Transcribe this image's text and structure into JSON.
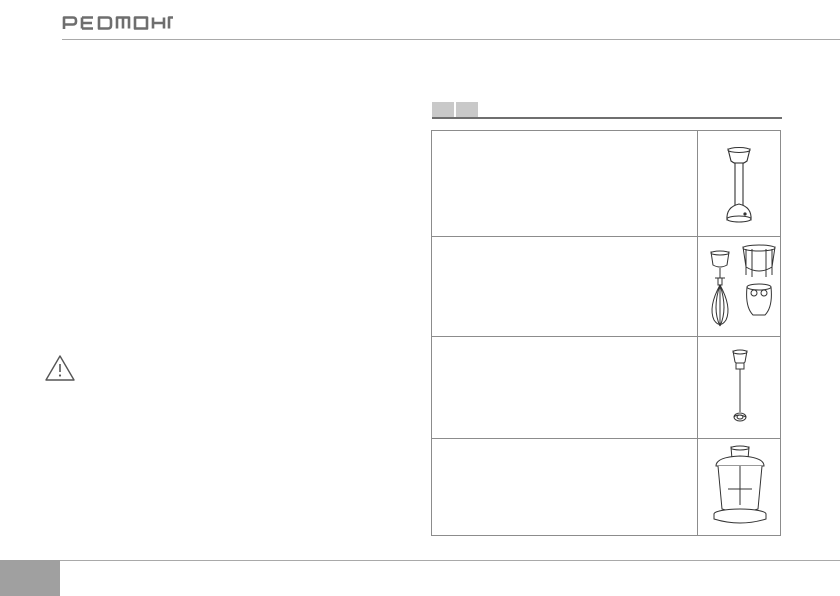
{
  "header": {
    "brand": "REDMOND"
  },
  "page": {
    "number": ""
  },
  "icons": {
    "warning": "warning-triangle-icon"
  },
  "attachments": [
    {
      "label": "",
      "icon": "blender-leg-icon"
    },
    {
      "label": "",
      "icon": "whisk-attachment-icon"
    },
    {
      "label": "",
      "icon": "mixing-beater-icon"
    },
    {
      "label": "",
      "icon": "chopper-bowl-icon"
    }
  ]
}
